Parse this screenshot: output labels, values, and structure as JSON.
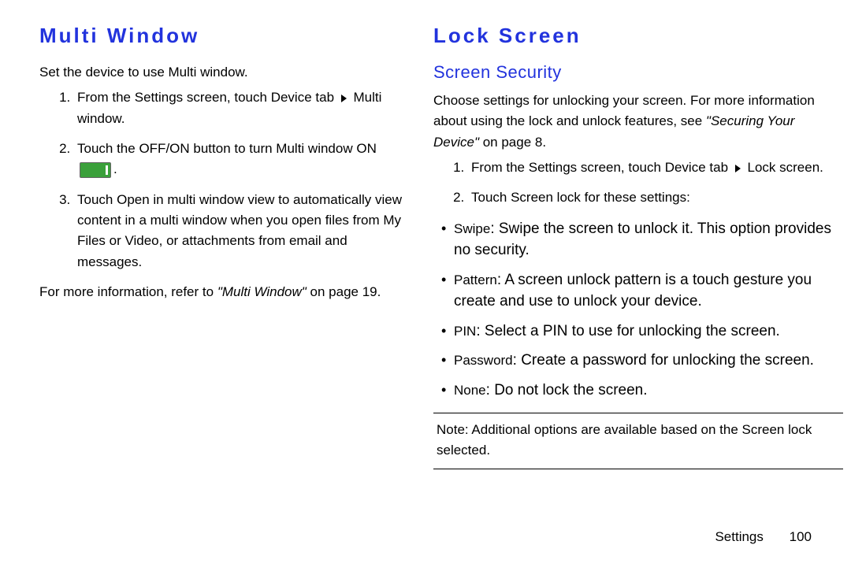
{
  "left": {
    "heading": "Multi Window",
    "intro": "Set the device to use Multi window.",
    "step1_a": "From the ",
    "step1_settings": "Settings",
    "step1_b": " screen, touch ",
    "step1_device": "Device",
    "step1_c": " tab ",
    "step1_target": "Multi window",
    "step1_end": ".",
    "step2_a": "Touch the ",
    "step2_offon": "OFF/ON",
    "step2_b": " button to turn Multi window ",
    "step2_on": "ON",
    "step2_end": ".",
    "step3_a": "Touch ",
    "step3_open": "Open in multi window view",
    "step3_b": " to automatically view content in a multi window when you open files from My Files or Video, or attachments from email and messages.",
    "moreinfo_a": "For more information, refer to ",
    "moreinfo_link": "\"Multi Window\"",
    "moreinfo_b": " on page 19."
  },
  "right": {
    "heading": "Lock Screen",
    "subheading": "Screen Security",
    "intro_a": "Choose settings for unlocking your screen. For more information about using the lock and unlock features, see ",
    "intro_link": "\"Securing Your Device\"",
    "intro_b": " on page 8.",
    "step1_a": "From the ",
    "step1_settings": "Settings",
    "step1_b": " screen, touch ",
    "step1_device": "Device",
    "step1_c": " tab ",
    "step1_target": "Lock screen",
    "step1_end": ".",
    "step2_a": "Touch ",
    "step2_screenlock": "Screen lock",
    "step2_b": " for these settings:",
    "opt_swipe_label": "Swipe",
    "opt_swipe_text": ": Swipe the screen to unlock it. This option provides no security.",
    "opt_pattern_label": "Pattern",
    "opt_pattern_text": ": A screen unlock pattern is a touch gesture you create and use to unlock your device.",
    "opt_pin_label": "PIN",
    "opt_pin_text": ": Select a PIN to use for unlocking the screen.",
    "opt_password_label": "Password",
    "opt_password_text": ": Create a password for unlocking the screen.",
    "opt_none_label": "None",
    "opt_none_text": ": Do not lock the screen.",
    "note_label": "Note:",
    "note_text": " Additional options are available based on the Screen lock selected."
  },
  "footer": {
    "section": "Settings",
    "page": "100"
  }
}
